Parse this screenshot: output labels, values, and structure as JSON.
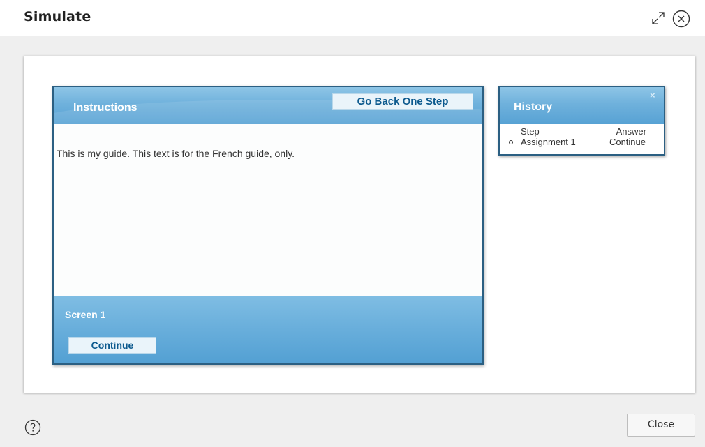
{
  "window": {
    "title": "Simulate",
    "expand_icon": "expand-icon",
    "close_icon": "close-circle-icon"
  },
  "instructions": {
    "title": "Instructions",
    "back_button": "Go Back One Step",
    "text": "This is my guide. This text is for the French guide, only.",
    "screen_label": "Screen 1",
    "continue_button": "Continue"
  },
  "history": {
    "title": "History",
    "close": "×",
    "headers": {
      "step": "Step",
      "answer": "Answer"
    },
    "rows": [
      {
        "step": "Assignment 1",
        "answer": "Continue"
      }
    ]
  },
  "footer": {
    "help_icon": "help-icon",
    "close_button": "Close"
  }
}
